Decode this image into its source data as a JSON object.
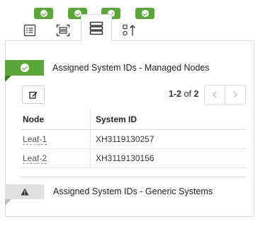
{
  "tabs": [
    {
      "name": "list",
      "icon": "list-icon",
      "status": "ok"
    },
    {
      "name": "scan",
      "icon": "scan-icon",
      "status": "ok"
    },
    {
      "name": "servers",
      "icon": "server-stack-icon",
      "status": "ok",
      "active": true
    },
    {
      "name": "sort",
      "icon": "sort-icon",
      "status": "ok"
    }
  ],
  "section1": {
    "title": "Assigned System IDs - Managed Nodes",
    "status_color": "#5ba63b",
    "pager": {
      "range": "1-2",
      "of": "of",
      "total": "2"
    },
    "columns": [
      "Node",
      "System ID"
    ],
    "rows": [
      {
        "node": "Leaf-1",
        "system_id": "XH3119130257"
      },
      {
        "node": "Leaf-2",
        "system_id": "XH3119130156"
      }
    ]
  },
  "section2": {
    "title": "Assigned System IDs - Generic Systems",
    "status": "warning"
  }
}
